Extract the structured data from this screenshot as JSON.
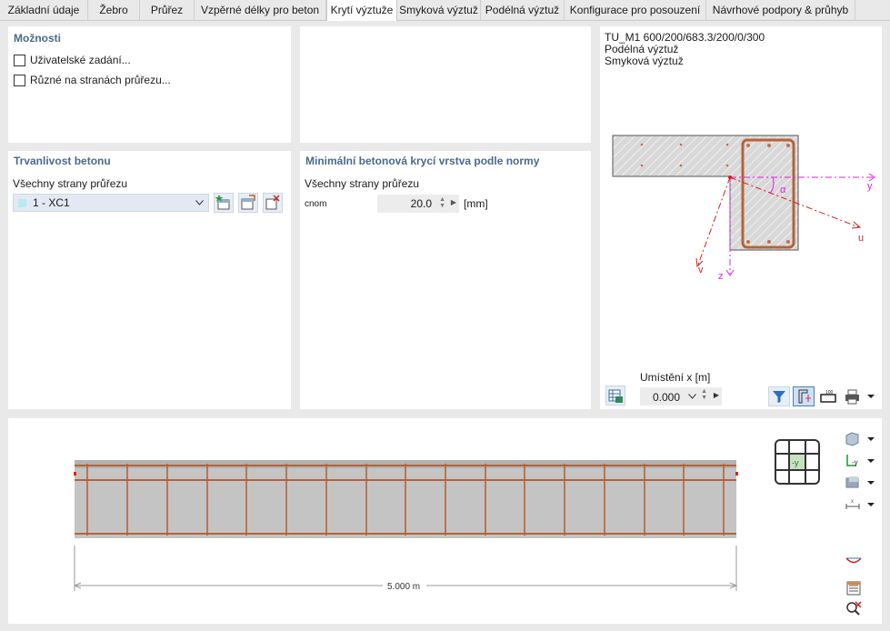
{
  "tabs": [
    {
      "label": "Základní údaje"
    },
    {
      "label": "Žebro"
    },
    {
      "label": "Průřez"
    },
    {
      "label": "Vzpěrné délky pro beton"
    },
    {
      "label": "Krytí výztuže"
    },
    {
      "label": "Smyková výztuž"
    },
    {
      "label": "Podélná výztuž"
    },
    {
      "label": "Konfigurace pro posouzení"
    },
    {
      "label": "Návrhové podpory & průhyb"
    }
  ],
  "options": {
    "title": "Možnosti",
    "user_input": "Uživatelské zadání...",
    "different_sides": "Různé na stranách průřezu..."
  },
  "durability": {
    "title": "Trvanlivost betonu",
    "all_sides": "Všechny strany průřezu",
    "selected": "1 - XC1"
  },
  "min_cover": {
    "title": "Minimální betonová krycí vrstva podle normy",
    "all_sides": "Všechny strany průřezu",
    "cnom_label": "cnom",
    "cnom_value": "20.0",
    "unit": "[mm]"
  },
  "section_view": {
    "line1": "TU_M1 600/200/683.3/200/0/300",
    "line2": "Podélná výztuž",
    "line3": "Smyková výztuž",
    "axis_y": "y",
    "axis_z": "z",
    "axis_u": "u",
    "axis_v": "v",
    "angle": "α",
    "location_label": "Umístění x [m]",
    "location_value": "0.000"
  },
  "beam_view": {
    "dimension": "5.000 m",
    "view_label": "-y"
  },
  "colors": {
    "accent": "#4a6a8a",
    "rebar": "#b5633a",
    "concrete": "#c4c4c4",
    "axis_pink": "#e020e0",
    "axis_red": "#d02020"
  }
}
